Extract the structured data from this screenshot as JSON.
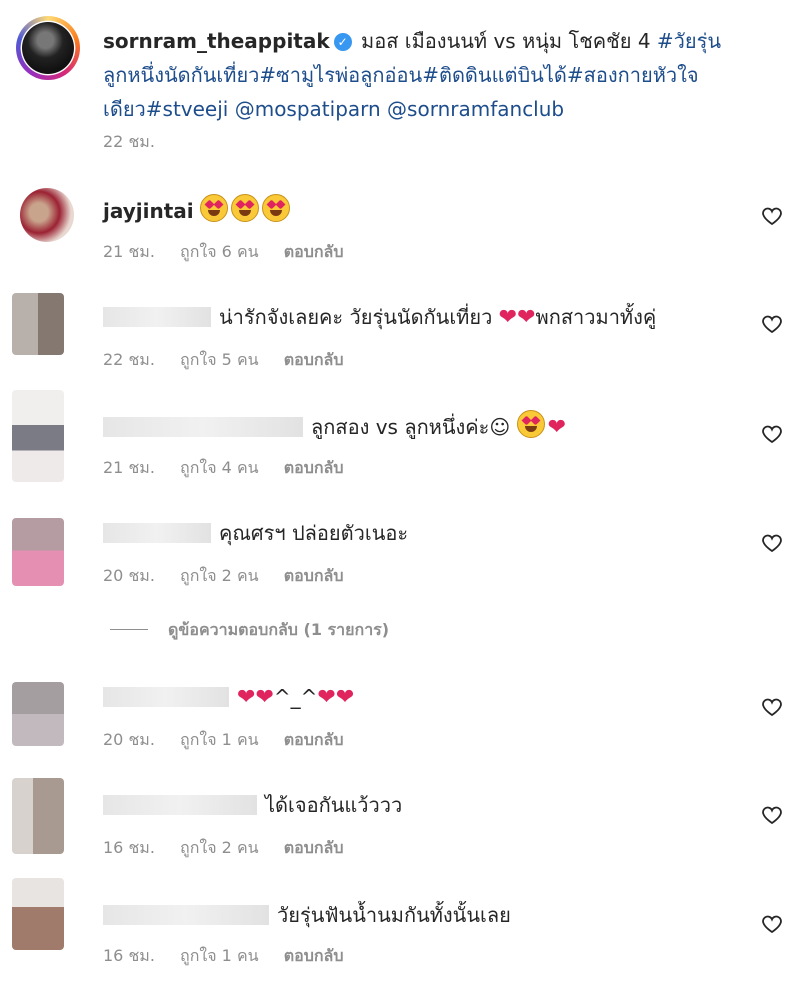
{
  "post": {
    "username": "sornram_theappitak",
    "caption_plain": "มอส เมืองนนท์ vs หนุ่ม โชคชัย 4",
    "caption_tags_line1": "#วัยรุ่น",
    "caption_line2": "ลูกหนึ่งนัดกันเที่ยว#ซามูไรพ่อลูกอ่อน#ติดดินแต่บินได้#สองกายหัวใจ",
    "caption_line3": "เดียว#stveeji @mospatiparn @sornramfanclub",
    "time": "22 ชม."
  },
  "comments": [
    {
      "user": "jayjintai",
      "text": "",
      "time": "21 ชม.",
      "likes": "ถูกใจ 6 คน",
      "reply": "ตอบกลับ"
    },
    {
      "user": "",
      "text": "น่ารักจังเลยคะ วัยรุ่นนัดกันเที่ยว",
      "text_after": "พกสาวมาทั้งคู่",
      "time": "22 ชม.",
      "likes": "ถูกใจ 5 คน",
      "reply": "ตอบกลับ"
    },
    {
      "user": "",
      "text": "ลูกสอง vs ลูกหนึ่งค่ะ☺",
      "time": "21 ชม.",
      "likes": "ถูกใจ 4 คน",
      "reply": "ตอบกลับ"
    },
    {
      "user": "",
      "text": "คุณศรฯ ปล่อยตัวเนอะ",
      "time": "20 ชม.",
      "likes": "ถูกใจ 2 คน",
      "reply": "ตอบกลับ"
    },
    {
      "user": "",
      "text": "^_^",
      "time": "20 ชม.",
      "likes": "ถูกใจ 1 คน",
      "reply": "ตอบกลับ"
    },
    {
      "user": "",
      "text": "ได้เจอกันแว้ววว",
      "time": "16 ชม.",
      "likes": "ถูกใจ 2 คน",
      "reply": "ตอบกลับ"
    },
    {
      "user": "",
      "text": "วัยรุ่นฟันน้ำนมกันทั้งนั้นเลย",
      "time": "16 ชม.",
      "likes": "ถูกใจ 1 คน",
      "reply": "ตอบกลับ"
    }
  ],
  "view_replies": "ดูข้อความตอบกลับ (1 รายการ)",
  "icons": {
    "like": "heart-outline-icon",
    "verified": "verified-badge-icon",
    "heart_emoji": "red-heart-emoji",
    "face_emoji": "heart-eyes-emoji"
  },
  "colors": {
    "hashtag": "#1e4d8c",
    "muted": "#8e8e8e",
    "verified": "#3897f0",
    "heart": "#e0245e"
  }
}
